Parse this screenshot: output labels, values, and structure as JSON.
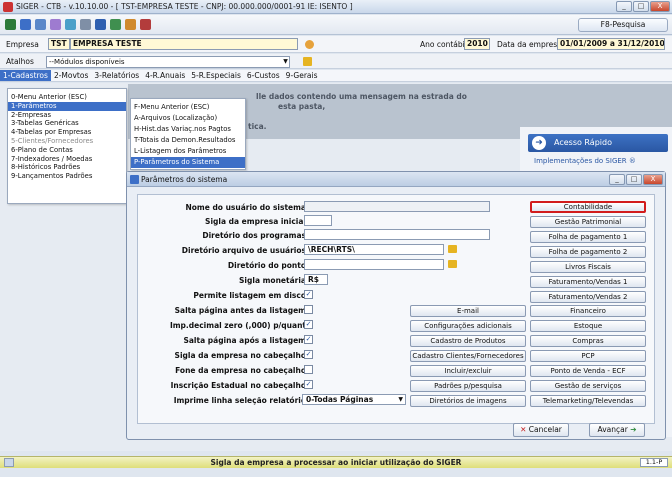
{
  "window": {
    "title": "SIGER - CTB - v.10.10.00 - [ TST-EMPRESA TESTE - CNPJ: 00.000.000/0001-91 IE: ISENTO ]",
    "min": "_",
    "max": "□",
    "close": "X"
  },
  "toolbar": {
    "f8_label": "F8-Pesquisa"
  },
  "empresa": {
    "label": "Empresa",
    "code": "TST",
    "name": "EMPRESA TESTE",
    "ano_label": "Ano contábil",
    "ano_value": "2010",
    "data_label": "Data da empresa",
    "data_value": "01/01/2009 a 31/12/2010"
  },
  "atalhos": {
    "label": "Atalhos",
    "value": "--Módulos disponíveis"
  },
  "menubar": [
    "1-Cadastros",
    "2-Movtos",
    "3-Relatórios",
    "4-R.Anuais",
    "5-R.Especiais",
    "6-Custos",
    "9-Gerais"
  ],
  "banner": {
    "line1": "lle dados contendo uma mensagem na estrada do",
    "line2": "esta pasta,",
    "line3": "tica."
  },
  "quick": {
    "title": "Acesso Rápido",
    "link": "Implementações do SIGER ®"
  },
  "menu1": [
    "0-Menu Anterior (ESC)",
    "1-Parâmetros",
    "2-Empresas",
    "3-Tabelas Genéricas",
    "4-Tabelas por Empresas",
    "5-Clientes/Fornecedores",
    "6-Plano de Contas",
    "7-Indexadores / Moedas",
    "8-Históricos Padrões",
    "9-Lançamentos Padrões"
  ],
  "menu2": [
    "F-Menu Anterior (ESC)",
    "A-Arquivos (Localização)",
    "H-Hist.das Variaç.nos Pagtos",
    "T-Totais da Demon.Resultados",
    "L-Listagem dos Parâmetros",
    "P-Parâmetros do Sistema"
  ],
  "dialog": {
    "title": "Parâmetros do sistema",
    "fields": [
      {
        "label": "Nome do usuário do sistema",
        "value": ""
      },
      {
        "label": "Sigla da empresa inicial",
        "value": ""
      },
      {
        "label": "Diretório dos programas",
        "value": ""
      },
      {
        "label": "Diretório arquivo de usuários",
        "value": "\\RECH\\RTS\\"
      },
      {
        "label": "Diretório do ponto",
        "value": ""
      },
      {
        "label": "Sigla monetária",
        "value": "R$"
      }
    ],
    "checks": [
      {
        "label": "Permite listagem em disco",
        "checked": "✓"
      },
      {
        "label": "Salta página antes da listagem",
        "checked": ""
      },
      {
        "label": "Imp.decimal zero (,000) p/quant",
        "checked": "✓"
      },
      {
        "label": "Salta página após a listagem",
        "checked": "✓"
      },
      {
        "label": "Sigla da empresa no cabeçalho",
        "checked": "✓"
      },
      {
        "label": "Fone da empresa no cabeçalho",
        "checked": ""
      },
      {
        "label": "Inscrição Estadual no cabeçalho",
        "checked": "✓"
      }
    ],
    "imprime_label": "Imprime linha seleção relatório",
    "imprime_value": "0-Todas Páginas",
    "mid_buttons": [
      "E-mail",
      "Configurações adicionais",
      "Cadastro de Produtos",
      "Cadastro Clientes/Fornecedores",
      "Incluir/excluir",
      "Padrões p/pesquisa",
      "Diretórios de imagens"
    ],
    "right_buttons": [
      "Contabilidade",
      "Gestão Patrimonial",
      "Folha de pagamento 1",
      "Folha de pagamento 2",
      "Livros Fiscais",
      "Faturamento/Vendas 1",
      "Faturamento/Vendas 2",
      "Financeiro",
      "Estoque",
      "Compras",
      "PCP",
      "Ponto de Venda - ECF",
      "Gestão de serviços",
      "Telemarketing/Televendas"
    ],
    "cancel": "Cancelar",
    "next": "Avançar"
  },
  "status": {
    "message": "Sigla da empresa a processar ao iniciar utilização do SIGER",
    "version": "1.1-P"
  }
}
